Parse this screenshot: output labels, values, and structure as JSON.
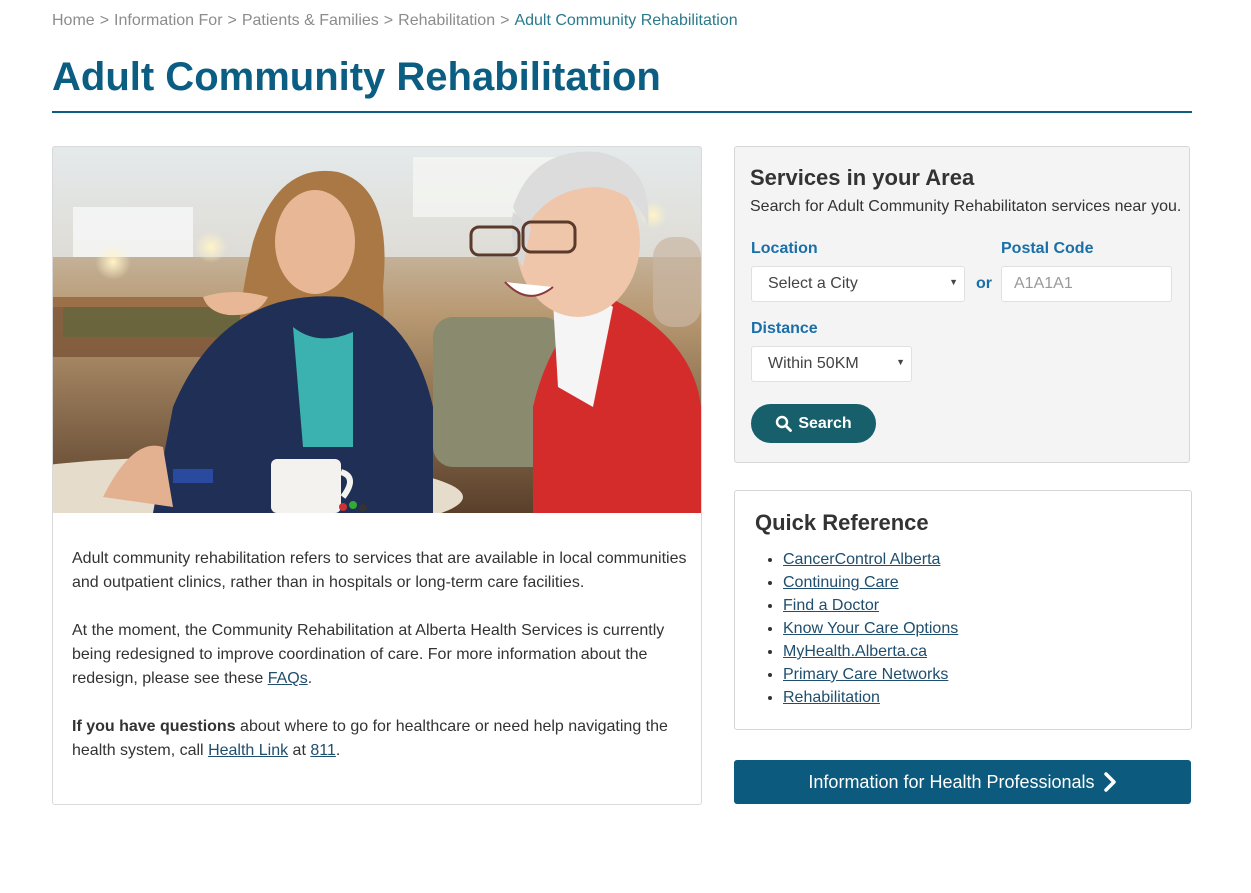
{
  "breadcrumb": {
    "items": [
      "Home",
      "Information For",
      "Patients & Families",
      "Rehabilitation"
    ],
    "separator": ">",
    "current": "Adult Community Rehabilitation"
  },
  "page": {
    "title": "Adult Community Rehabilitation"
  },
  "article": {
    "p1": "Adult community rehabilitation refers to services that are available in local communities and outpatient clinics, rather than in hospitals or long-term care facilities.",
    "p2_before": "At the moment, the Community Rehabilitation at Alberta Health Services is currently being redesigned to improve coordination of care. For more information about the redesign, please see these ",
    "p2_link": "FAQs",
    "p2_after": ".",
    "p3_bold": "If you have questions",
    "p3_mid": " about where to go for healthcare or need help navigating the health system, call ",
    "p3_link1": "Health Link",
    "p3_at": " at ",
    "p3_link2": "811",
    "p3_end": "."
  },
  "services": {
    "title": "Services in your Area",
    "subtitle": "Search for Adult Community Rehabilitaton services near you.",
    "location_label": "Location",
    "location_value": "Select a City",
    "or_label": "or",
    "postal_label": "Postal Code",
    "postal_placeholder": "A1A1A1",
    "distance_label": "Distance",
    "distance_value": "Within 50KM",
    "search_button": "Search"
  },
  "quick_reference": {
    "title": "Quick Reference",
    "links": [
      "CancerControl Alberta",
      "Continuing Care",
      "Find a Doctor",
      "Know Your Care Options",
      "MyHealth.Alberta.ca",
      "Primary Care Networks",
      "Rehabilitation"
    ]
  },
  "health_professionals_button": "Information for Health Professionals",
  "colors": {
    "title_blue": "#0b5d82",
    "label_blue": "#1a6fa8",
    "search_teal": "#175f6b",
    "cta_blue": "#0c5a7d",
    "link_blue": "#1f4e6e"
  },
  "icons": [
    "search-icon",
    "chevron-right-icon",
    "dropdown-arrow-icon"
  ]
}
